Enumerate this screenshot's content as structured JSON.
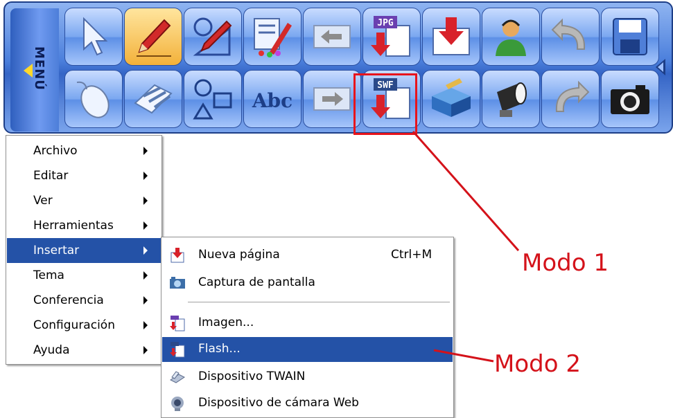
{
  "toolbar": {
    "menu_label": "MENÚ",
    "row1": [
      {
        "icon": "pointer-icon"
      },
      {
        "icon": "pen-icon"
      },
      {
        "icon": "shapes-pen-icon"
      },
      {
        "icon": "properties-icon"
      },
      {
        "icon": "back-arrow-icon"
      },
      {
        "icon": "jpg-insert-icon",
        "badge": "JPG"
      },
      {
        "icon": "new-page-icon"
      },
      {
        "icon": "conference-user-icon"
      },
      {
        "icon": "undo-icon"
      },
      {
        "icon": "save-icon"
      }
    ],
    "row2": [
      {
        "icon": "mouse-icon"
      },
      {
        "icon": "eraser-icon"
      },
      {
        "icon": "shapes-icon"
      },
      {
        "icon": "text-icon",
        "text": "Abc"
      },
      {
        "icon": "forward-arrow-icon"
      },
      {
        "icon": "swf-insert-icon",
        "badge": "SWF"
      },
      {
        "icon": "toolbox-icon"
      },
      {
        "icon": "spotlight-icon"
      },
      {
        "icon": "redo-icon"
      },
      {
        "icon": "camera-icon"
      }
    ]
  },
  "main_menu": {
    "items": [
      {
        "label": "Archivo"
      },
      {
        "label": "Editar"
      },
      {
        "label": "Ver"
      },
      {
        "label": "Herramientas"
      },
      {
        "label": "Insertar"
      },
      {
        "label": "Tema"
      },
      {
        "label": "Conferencia"
      },
      {
        "label": "Configuración"
      },
      {
        "label": "Ayuda"
      }
    ],
    "selected_index": 4
  },
  "sub_menu": {
    "items": [
      {
        "label": "Nueva página",
        "shortcut": "Ctrl+M",
        "icon": "new-page-icon"
      },
      {
        "label": "Captura de pantalla",
        "icon": "screenshot-icon"
      },
      {
        "label": "Imagen...",
        "icon": "image-insert-icon"
      },
      {
        "label": "Flash...",
        "icon": "flash-insert-icon"
      },
      {
        "label": "Dispositivo TWAIN",
        "icon": "scanner-icon"
      },
      {
        "label": "Dispositivo de cámara Web",
        "icon": "webcam-icon"
      }
    ],
    "selected_index": 3
  },
  "annotations": {
    "mode1": "Modo 1",
    "mode2": "Modo 2",
    "color": "#d4121a"
  },
  "colors": {
    "menu_highlight": "#2452a7",
    "toolbar_blue": "#4b7fdc"
  }
}
